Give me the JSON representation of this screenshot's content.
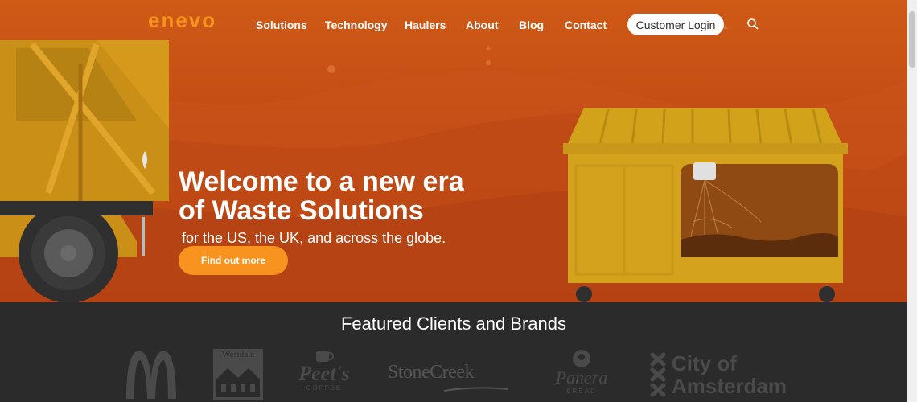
{
  "brand": {
    "logo_text": "enevo",
    "colors": {
      "accent": "#f7931e",
      "hero": "#c24a14",
      "footer": "#2b2b2b"
    }
  },
  "nav": {
    "links": [
      "Solutions",
      "Technology",
      "Haulers",
      "About",
      "Blog",
      "Contact"
    ],
    "login_label": "Customer Login",
    "search_icon": "search-icon"
  },
  "hero": {
    "headline_line1": "Welcome to a new era",
    "headline_line2": "of Waste Solutions",
    "subhead": "for the US, the UK, and across the globe.",
    "cta_label": "Find out more"
  },
  "clients": {
    "title": "Featured Clients and Brands",
    "logos": [
      {
        "name": "mcdonalds-logo"
      },
      {
        "name": "westdale-logo",
        "text": "Westdale"
      },
      {
        "name": "peets-coffee-logo",
        "text": "Peet's",
        "sub": "COFFEE"
      },
      {
        "name": "stonecreek-logo",
        "text": "StoneCreek"
      },
      {
        "name": "panera-bread-logo",
        "text": "Panera",
        "sub": "BREAD"
      },
      {
        "name": "city-of-amsterdam-logo",
        "line1": "City of",
        "line2": "Amsterdam"
      }
    ]
  }
}
